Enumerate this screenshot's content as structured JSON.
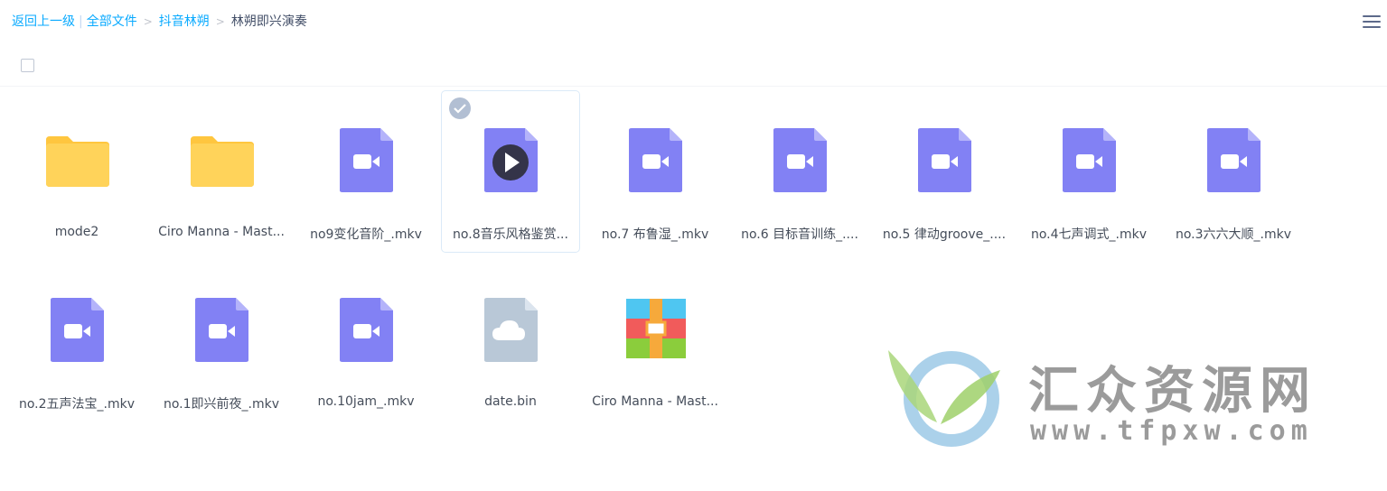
{
  "breadcrumb": {
    "back": "返回上一级",
    "separator": "|",
    "root": "全部文件",
    "parent": "抖音林朔",
    "current": "林朔即兴演奏"
  },
  "colors": {
    "link": "#09aaff",
    "folder": "#ffd35a",
    "video": "#8281f4",
    "cloud": "#b9c8d7",
    "selected_border": "#dbeaf8"
  },
  "files": [
    {
      "name": "mode2",
      "type": "folder-icon",
      "selected": false
    },
    {
      "name": "Ciro Manna - Mast...",
      "type": "folder-icon",
      "selected": false
    },
    {
      "name": "no9变化音阶_.mkv",
      "type": "video-file-icon",
      "selected": false
    },
    {
      "name": "no.8音乐风格鉴赏...",
      "type": "video-file-icon",
      "selected": true
    },
    {
      "name": "no.7 布鲁湿_.mkv",
      "type": "video-file-icon",
      "selected": false
    },
    {
      "name": "no.6 目标音训练_....",
      "type": "video-file-icon",
      "selected": false
    },
    {
      "name": "no.5 律动groove_....",
      "type": "video-file-icon",
      "selected": false
    },
    {
      "name": "no.4七声调式_.mkv",
      "type": "video-file-icon",
      "selected": false
    },
    {
      "name": "no.3六六大顺_.mkv",
      "type": "video-file-icon",
      "selected": false
    },
    {
      "name": "no.2五声法宝_.mkv",
      "type": "video-file-icon",
      "selected": false
    },
    {
      "name": "no.1即兴前夜_.mkv",
      "type": "video-file-icon",
      "selected": false
    },
    {
      "name": "no.10jam_.mkv",
      "type": "video-file-icon",
      "selected": false
    },
    {
      "name": "date.bin",
      "type": "cloud-file-icon",
      "selected": false
    },
    {
      "name": "Ciro Manna - Mast...",
      "type": "archive-icon",
      "selected": false
    }
  ],
  "watermark": {
    "title": "汇众资源网",
    "url": "www.tfpxw.com"
  }
}
